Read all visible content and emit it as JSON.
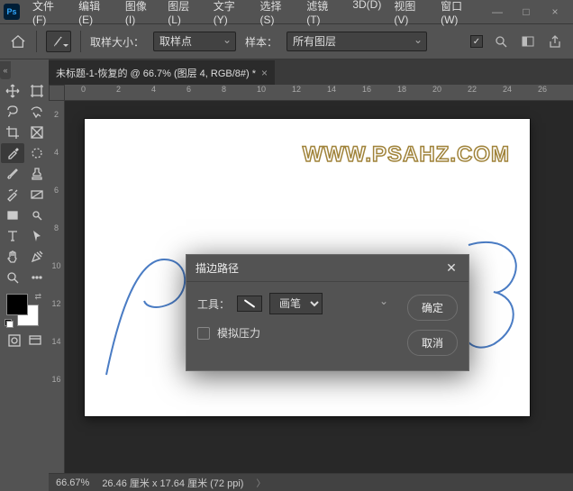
{
  "app": {
    "logo": "Ps"
  },
  "menu": [
    "文件(F)",
    "编辑(E)",
    "图像(I)",
    "图层(L)",
    "文字(Y)",
    "选择(S)",
    "滤镜(T)",
    "3D(D)",
    "视图(V)",
    "窗口(W)"
  ],
  "window_controls": {
    "min": "—",
    "max": "□",
    "close": "×"
  },
  "options": {
    "sample_size_label": "取样大小：",
    "sample_size_value": "取样点",
    "sample_label": "样本：",
    "sample_value": "所有图层",
    "checkbox_checked": "✓"
  },
  "document": {
    "tab_title": "未标题-1-恢复的 @ 66.7% (图层 4, RGB/8#) *"
  },
  "ruler_h": [
    "0",
    "2",
    "4",
    "6",
    "8",
    "10",
    "12",
    "14",
    "16",
    "18",
    "20",
    "22",
    "24",
    "26"
  ],
  "ruler_v": [
    "2",
    "4",
    "6",
    "8",
    "10",
    "12",
    "14",
    "16"
  ],
  "canvas": {
    "watermark": "WWW.PSAHZ.COM"
  },
  "status": {
    "zoom": "66.67%",
    "docsize": "26.46 厘米 x 17.64 厘米 (72 ppi)",
    "arrow": "〉"
  },
  "dialog": {
    "title": "描边路径",
    "tool_label": "工具：",
    "tool_value": "画笔",
    "pressure_label": "模拟压力",
    "ok": "确定",
    "cancel": "取消",
    "close_glyph": "✕"
  },
  "colors": {
    "fg": "#000000",
    "bg": "#ffffff"
  }
}
